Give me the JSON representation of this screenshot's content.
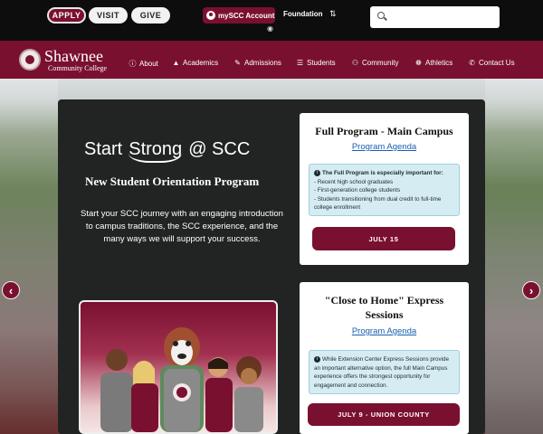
{
  "utility": {
    "apply": "APPLY",
    "visit": "VISIT",
    "give": "GIVE",
    "myscc": "mySCC Account",
    "foundation": "Foundation",
    "search_placeholder": ""
  },
  "brand": {
    "name": "Shawnee",
    "sub": "Community College"
  },
  "nav": [
    {
      "label": "About",
      "icon": "info-icon"
    },
    {
      "label": "Academics",
      "icon": "graduation-cap-icon"
    },
    {
      "label": "Admissions",
      "icon": "pencil-icon"
    },
    {
      "label": "Students",
      "icon": "menu-icon"
    },
    {
      "label": "Community",
      "icon": "users-icon"
    },
    {
      "label": "Athletics",
      "icon": "paw-icon"
    },
    {
      "label": "Contact Us",
      "icon": "phone-icon"
    }
  ],
  "hero": {
    "start": "Start",
    "strong": "Strong",
    "at_scc": "@ SCC",
    "subhead": "New Student Orientation Program",
    "intro": "Start your SCC journey with an engaging introduction to campus traditions, the SCC experience, and the many ways we will support your success."
  },
  "cards": [
    {
      "title": "Full Program - Main Campus",
      "link": "Program Agenda",
      "info_heading": "The Full Program is especially important for:",
      "info_lines": [
        "- Recent high school graduates",
        "- First-generation college students",
        "- Students transitioning from dual credit to full-time college enrollment"
      ],
      "button": "JULY 15"
    },
    {
      "title": "\"Close to Home\" Express Sessions",
      "link": "Program Agenda",
      "info_text": "While Extension Center Express Sessions provide an important alternative option, the full Main Campus experience offers the strongest opportunity for engagement and connection.",
      "button": "JULY 9 - UNION COUNTY"
    }
  ],
  "carousel": {
    "prev": "‹",
    "next": "›"
  }
}
